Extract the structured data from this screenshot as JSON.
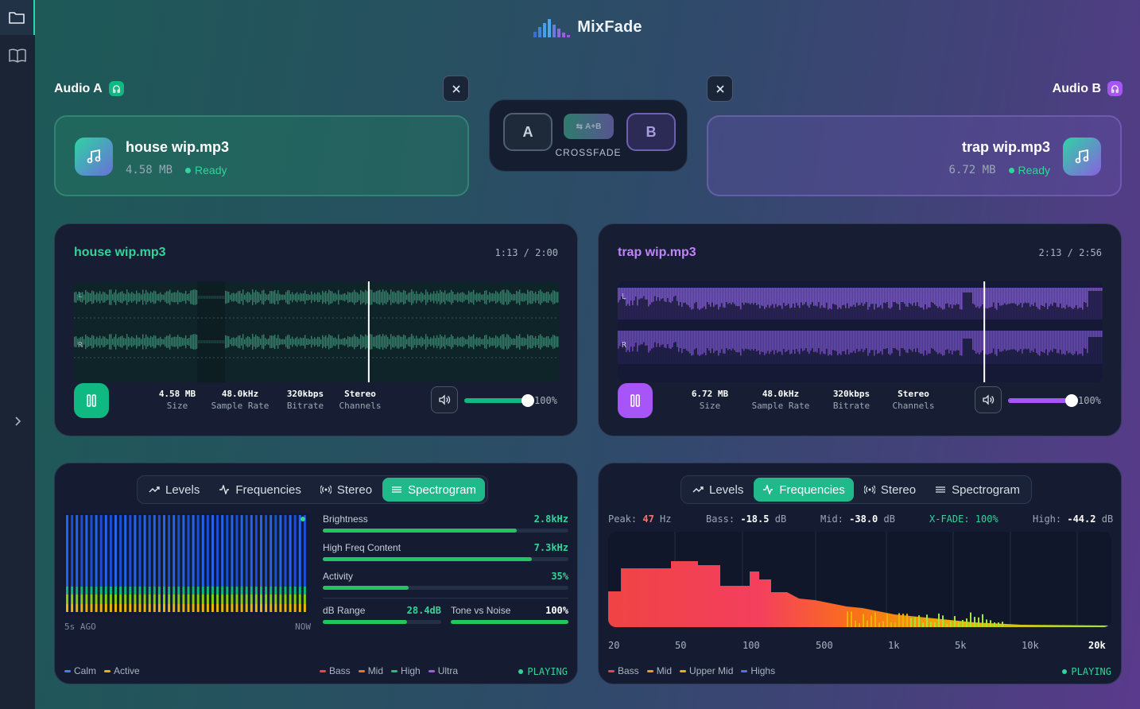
{
  "app": {
    "title": "MixFade"
  },
  "sidebar": {
    "items": [
      {
        "icon": "folder-icon"
      },
      {
        "icon": "book-icon"
      }
    ],
    "expand_icon": "chevron-right-icon"
  },
  "slot_a": {
    "label": "Audio A",
    "file": {
      "name": "house wip.mp3",
      "size": "4.58 MB",
      "status": "Ready"
    }
  },
  "slot_b": {
    "label": "Audio B",
    "file": {
      "name": "trap wip.mp3",
      "size": "6.72 MB",
      "status": "Ready"
    }
  },
  "crossfade": {
    "a_label": "A",
    "ab_label": "A+B",
    "b_label": "B",
    "caption": "CROSSFADE"
  },
  "player_a": {
    "title": "house wip.mp3",
    "time": "1:13 / 2:00",
    "channel_l": "L",
    "channel_r": "R",
    "stats": [
      {
        "value": "4.58 MB",
        "label": "Size"
      },
      {
        "value": "48.0kHz",
        "label": "Sample Rate"
      },
      {
        "value": "320kbps",
        "label": "Bitrate"
      },
      {
        "value": "Stereo",
        "label": "Channels"
      }
    ],
    "volume": "100%",
    "volume_fraction": 1.0,
    "progress": 0.608,
    "accent": "#2dd4a4"
  },
  "player_b": {
    "title": "trap wip.mp3",
    "time": "2:13 / 2:56",
    "channel_l": "L",
    "channel_r": "R",
    "stats": [
      {
        "value": "6.72 MB",
        "label": "Size"
      },
      {
        "value": "48.0kHz",
        "label": "Sample Rate"
      },
      {
        "value": "320kbps",
        "label": "Bitrate"
      },
      {
        "value": "Stereo",
        "label": "Channels"
      }
    ],
    "volume": "100%",
    "volume_fraction": 1.0,
    "progress": 0.756,
    "accent": "#a855f7"
  },
  "analyzer_a": {
    "tabs": [
      {
        "label": "Levels",
        "icon": "trend-icon"
      },
      {
        "label": "Frequencies",
        "icon": "pulse-icon"
      },
      {
        "label": "Stereo",
        "icon": "radio-icon"
      },
      {
        "label": "Spectrogram",
        "icon": "sliders-icon",
        "active": true
      }
    ],
    "time_start": "5s AGO",
    "time_end": "NOW",
    "metrics": {
      "brightness": {
        "label": "Brightness",
        "value": "2.8kHz",
        "fraction": 0.79
      },
      "high_freq": {
        "label": "High Freq Content",
        "value": "7.3kHz",
        "fraction": 0.85
      },
      "activity": {
        "label": "Activity",
        "value": "35%",
        "fraction": 0.35
      },
      "db_range": {
        "label": "dB Range",
        "value": "28.4dB",
        "fraction": 0.71
      },
      "tone_noise": {
        "label": "Tone vs Noise",
        "value": "100%",
        "fraction": 1.0
      }
    },
    "legend_left": [
      {
        "label": "Calm",
        "color": "#3b82f6"
      },
      {
        "label": "Active",
        "color": "#eab308"
      }
    ],
    "legend_right": [
      {
        "label": "Bass",
        "color": "#ef4444"
      },
      {
        "label": "Mid",
        "color": "#f97316"
      },
      {
        "label": "High",
        "color": "#22c55e"
      },
      {
        "label": "Ultra",
        "color": "#a855f7"
      }
    ],
    "status": "PLAYING"
  },
  "analyzer_b": {
    "tabs": [
      {
        "label": "Levels",
        "icon": "trend-icon"
      },
      {
        "label": "Frequencies",
        "icon": "pulse-icon",
        "active": true
      },
      {
        "label": "Stereo",
        "icon": "radio-icon"
      },
      {
        "label": "Spectrogram",
        "icon": "sliders-icon"
      }
    ],
    "peak_label": "Peak:",
    "peak_value": "47",
    "peak_unit": "Hz",
    "bass_label": "Bass:",
    "bass_value": "-18.5",
    "bass_unit": "dB",
    "mid_label": "Mid:",
    "mid_value": "-38.0",
    "mid_unit": "dB",
    "xfade": "X-FADE: 100%",
    "high_label": "High:",
    "high_value": "-44.2",
    "high_unit": "dB",
    "freq_ticks": [
      "20",
      "50",
      "100",
      "500",
      "1k",
      "5k",
      "10k",
      "20k"
    ],
    "legend": [
      {
        "label": "Bass",
        "color": "#ef4444"
      },
      {
        "label": "Mid",
        "color": "#f59e0b"
      },
      {
        "label": "Upper Mid",
        "color": "#eab308"
      },
      {
        "label": "Highs",
        "color": "#6366f1"
      }
    ],
    "status": "PLAYING"
  }
}
